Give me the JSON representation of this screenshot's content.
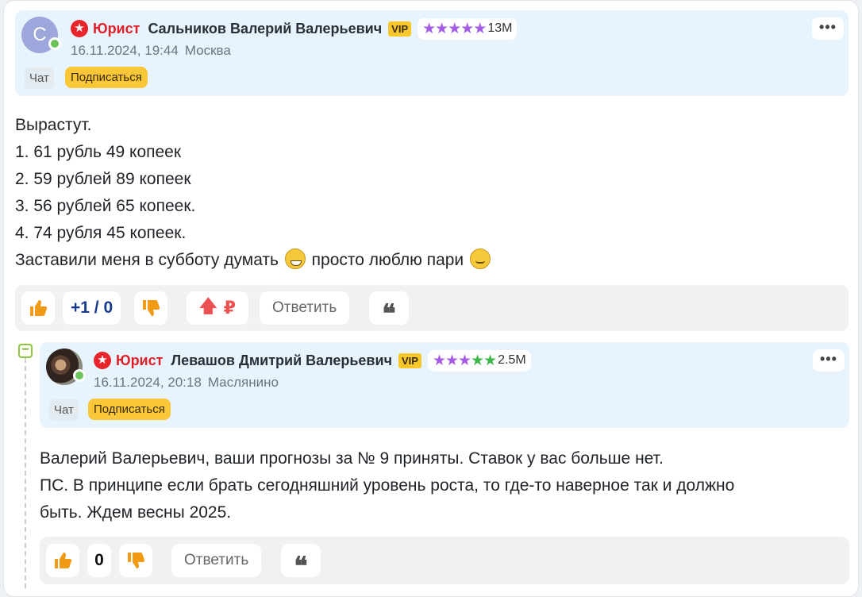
{
  "comment1": {
    "avatar_letter": "С",
    "role": "Юрист",
    "name": "Сальников Валерий Валерьевич",
    "vip": "VIP",
    "rating_value": "13M",
    "date": "16.11.2024, 19:44",
    "city": "Москва",
    "chat_label": "Чат",
    "subscribe_label": "Подписаться",
    "more_label": "•••",
    "lines": [
      "Вырастут.",
      "1. 61 рубль 49 копеек",
      "2. 59 рублей 89 копеек",
      "3. 56 рублей 65 копеек.",
      "4. 74 рубля 45 копеек."
    ],
    "last_line_a": "Заставили меня в субботу думать ",
    "last_line_b": " просто люблю пари ",
    "score": "+1 / 0",
    "reply_label": "Ответить",
    "quote_label": "❝",
    "donate_label": "₽"
  },
  "comment2": {
    "role": "Юрист",
    "name": "Левашов Дмитрий Валерьевич",
    "vip": "VIP",
    "rating_value": "2.5M",
    "date": "16.11.2024, 20:18",
    "city": "Маслянино",
    "chat_label": "Чат",
    "subscribe_label": "Подписаться",
    "more_label": "•••",
    "lines": [
      "Валерий Валерьевич, ваши прогнозы за № 9 приняты. Ставок у вас больше нет.",
      "ПС. В принципе если брать сегодняшний уровень роста, то где-то наверное так и должно",
      "быть. Ждем весны 2025."
    ],
    "score": "0",
    "reply_label": "Ответить",
    "quote_label": "❝"
  },
  "collapse_label": "−",
  "icons": {
    "role": "red-star-badge-icon",
    "like": "thumbs-up-icon",
    "dislike": "thumbs-down-icon",
    "donate": "arrow-up-ruble-icon",
    "quote": "quote-icon"
  },
  "colors": {
    "accent_yellow": "#f9c737",
    "role_red": "#e02028",
    "stars_purple": "#a45ce6",
    "stars_green": "#3cb94a",
    "like_orange": "#f09a16"
  }
}
